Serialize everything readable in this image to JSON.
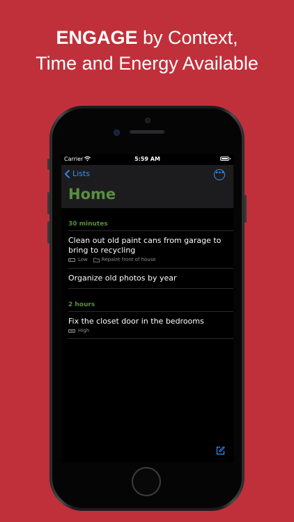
{
  "headline": {
    "bold": "ENGAGE",
    "rest_line1": " by Context,",
    "line2": "Time and Energy Available"
  },
  "status_bar": {
    "carrier": "Carrier",
    "time": "5:59 AM"
  },
  "nav": {
    "back_label": "Lists",
    "title": "Home"
  },
  "sections": [
    {
      "header": "30 minutes",
      "tasks": [
        {
          "title": "Clean out old paint cans from garage to bring to recycling",
          "energy": "Low",
          "project": "Repaint front of house"
        },
        {
          "title": "Organize old photos by year"
        }
      ]
    },
    {
      "header": "2 hours",
      "tasks": [
        {
          "title": "Fix the closet door in the bedrooms",
          "energy": "High"
        }
      ]
    }
  ],
  "colors": {
    "background": "#c0303a",
    "accent_blue": "#3a8ff7",
    "accent_green": "#5a8f3f"
  },
  "icons": [
    "wifi-icon",
    "battery-icon",
    "chevron-left-icon",
    "more-icon",
    "energy-low-icon",
    "folder-icon",
    "energy-high-icon",
    "compose-icon"
  ]
}
